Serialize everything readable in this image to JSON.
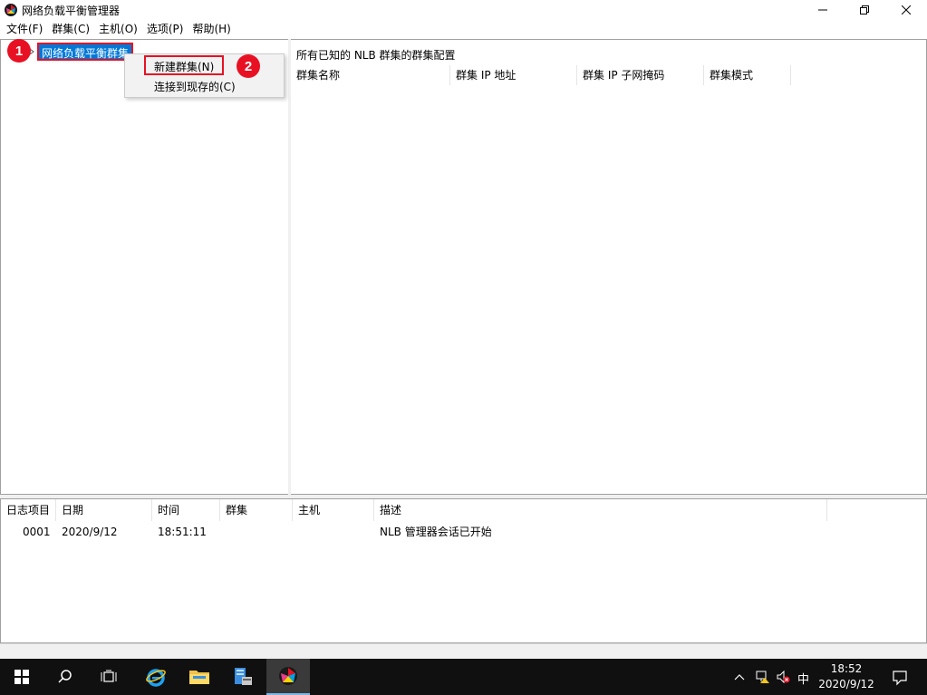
{
  "window": {
    "title": "网络负载平衡管理器"
  },
  "menu": {
    "items": [
      "文件(F)",
      "群集(C)",
      "主机(O)",
      "选项(P)",
      "帮助(H)"
    ]
  },
  "tree": {
    "root_label": "网络负载平衡群集"
  },
  "context_menu": {
    "items": [
      "新建群集(N)",
      "连接到现存的(C)"
    ]
  },
  "annotations": {
    "step1": "1",
    "step2": "2"
  },
  "right_pane": {
    "header": "所有已知的 NLB 群集的群集配置",
    "columns": [
      "群集名称",
      "群集 IP 地址",
      "群集 IP 子网掩码",
      "群集模式"
    ]
  },
  "log": {
    "columns": [
      "日志项目",
      "日期",
      "时间",
      "群集",
      "主机",
      "描述"
    ],
    "rows": [
      {
        "id": "0001",
        "date": "2020/9/12",
        "time": "18:51:11",
        "cluster": "",
        "host": "",
        "desc": "NLB 管理器会话已开始"
      }
    ]
  },
  "taskbar": {
    "ime": "中",
    "time": "18:52",
    "date": "2020/9/12"
  },
  "colors": {
    "selection": "#0078d7",
    "annotation": "#e81123",
    "taskbar": "#101010"
  }
}
